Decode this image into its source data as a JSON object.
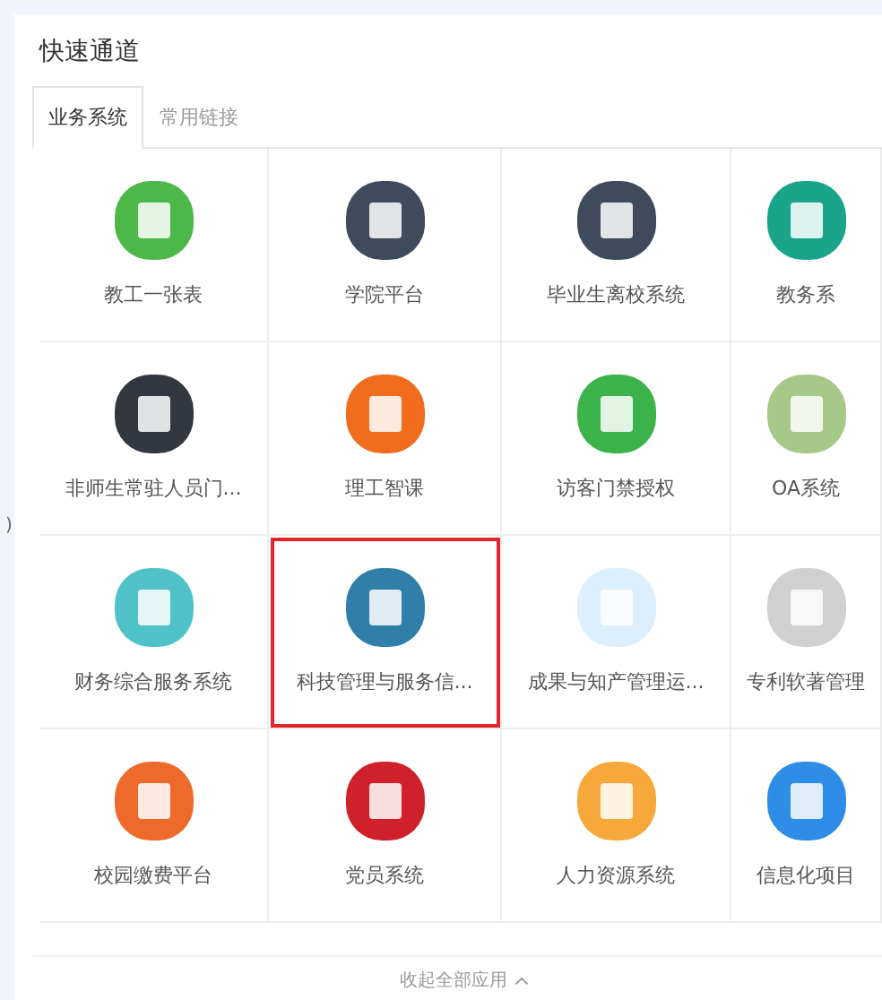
{
  "side_fragment": ")",
  "panel": {
    "title": "快速通道"
  },
  "tabs": [
    {
      "label": "业务系统",
      "selected": true
    },
    {
      "label": "常用链接",
      "selected": false
    }
  ],
  "apps": [
    {
      "name": "教工一张表",
      "color": "#4cb84a",
      "highlighted": false
    },
    {
      "name": "学院平台",
      "color": "#3f4a5c",
      "highlighted": false
    },
    {
      "name": "毕业生离校系统",
      "color": "#3f4a5c",
      "highlighted": false
    },
    {
      "name": "教务系",
      "color": "#1aa58a",
      "highlighted": false
    },
    {
      "name": "非师生常驻人员门...",
      "color": "#333840",
      "highlighted": false
    },
    {
      "name": "理工智课",
      "color": "#f26c1e",
      "highlighted": false
    },
    {
      "name": "访客门禁授权",
      "color": "#3bb34a",
      "highlighted": false
    },
    {
      "name": "OA系统",
      "color": "#a6c98a",
      "highlighted": false
    },
    {
      "name": "财务综合服务系统",
      "color": "#4fc2c8",
      "highlighted": false
    },
    {
      "name": "科技管理与服务信...",
      "color": "#2f7fa8",
      "highlighted": true
    },
    {
      "name": "成果与知产管理运...",
      "color": "#dcefff",
      "highlighted": false
    },
    {
      "name": "专利软著管理",
      "color": "#d0d0d0",
      "highlighted": false
    },
    {
      "name": "校园缴费平台",
      "color": "#ee6a2a",
      "highlighted": false
    },
    {
      "name": "党员系统",
      "color": "#d0202a",
      "highlighted": false
    },
    {
      "name": "人力资源系统",
      "color": "#f6a83a",
      "highlighted": false
    },
    {
      "name": "信息化项目",
      "color": "#2e8de6",
      "highlighted": false
    }
  ],
  "footer": {
    "label": "收起全部应用"
  }
}
